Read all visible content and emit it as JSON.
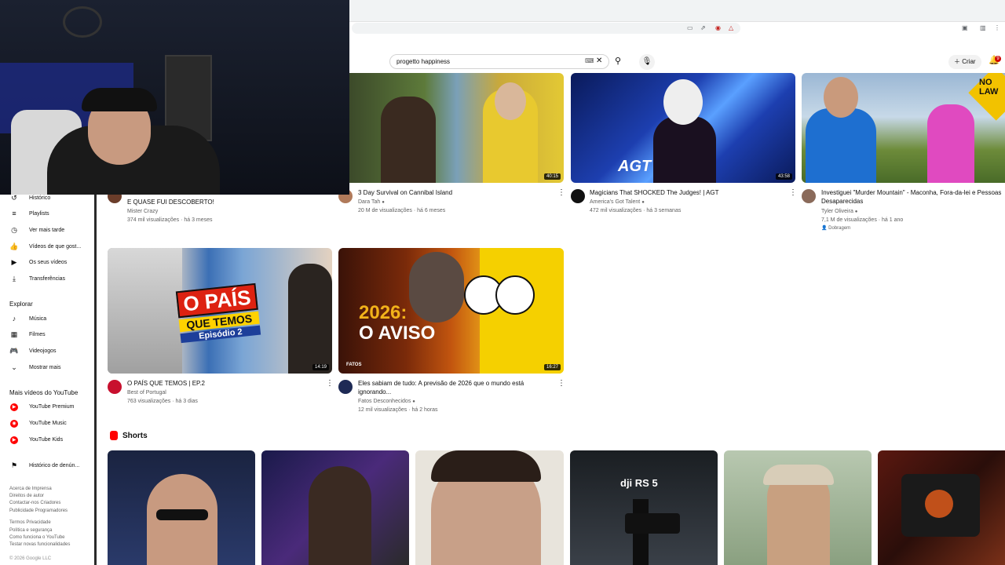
{
  "search": {
    "query": "progetto happiness"
  },
  "header": {
    "create_label": "Criar",
    "notifications_count": "9"
  },
  "sidebar": {
    "items_top": [
      {
        "label": "Histórico",
        "icon": "history-icon"
      },
      {
        "label": "Playlists",
        "icon": "playlist-icon"
      },
      {
        "label": "Ver mais tarde",
        "icon": "clock-icon"
      },
      {
        "label": "Vídeos de que gost...",
        "icon": "thumb-up-icon"
      },
      {
        "label": "Os seus vídeos",
        "icon": "video-icon"
      },
      {
        "label": "Transferências",
        "icon": "download-icon"
      }
    ],
    "explore_heading": "Explorar",
    "explore_items": [
      {
        "label": "Música",
        "icon": "music-icon"
      },
      {
        "label": "Filmes",
        "icon": "film-icon"
      },
      {
        "label": "Videojogos",
        "icon": "gamepad-icon"
      },
      {
        "label": "Mostrar mais",
        "icon": "chevron-down-icon"
      }
    ],
    "more_heading": "Mais vídeos do YouTube",
    "more_items": [
      {
        "label": "YouTube Premium"
      },
      {
        "label": "YouTube Music"
      },
      {
        "label": "YouTube Kids"
      }
    ],
    "report_label": "Histórico de denún...",
    "footer_lines": [
      "Acerca de  Imprensa",
      "Direitos de autor",
      "Contactar-nos  Criadores",
      "Publicidade  Programadores",
      "Termos  Privacidade",
      "Política e segurança",
      "Como funciona o YouTube",
      "Testar novas funcionalidades"
    ],
    "copyright": "© 2026 Google LLC"
  },
  "row1": [
    {
      "title": "E QUASE FUI DESCOBERTO!",
      "channel": "Mister Crazy",
      "stats": "374 mil visualizações · há 3 meses"
    },
    {
      "title": "3 Day Survival on Cannibal Island",
      "channel": "Dara Tah",
      "stats": "20 M de visualizações · há 6 meses",
      "duration": "40:15"
    },
    {
      "title": "Magicians That SHOCKED The Judges! | AGT",
      "channel": "America's Got Talent",
      "stats": "472 mil visualizações · há 3 semanas",
      "duration": "43:58"
    },
    {
      "title": "Investiguei \"Murder Mountain\" - Maconha, Fora-da-lei e Pessoas Desaparecidas",
      "channel": "Tyler Oliveira",
      "stats": "7,1 M de visualizações · há 1 ano",
      "badge": "Dobragem"
    }
  ],
  "row2": [
    {
      "title": "O PAÍS QUE TEMOS | EP.2",
      "channel": "Best of Portugal",
      "stats": "763 visualizações · há 3 dias",
      "duration": "14:19",
      "thumb_text_1": "O PAÍS",
      "thumb_text_2": "QUE TEMOS",
      "thumb_text_3": "Episódio 2"
    },
    {
      "title": "Eles sabiam de tudo: A previsão de 2026 que o mundo está ignorando...",
      "channel": "Fatos Desconhecidos",
      "stats": "12 mil visualizações · há 2 horas",
      "duration": "16:27",
      "thumb_text_1": "2026:",
      "thumb_text_2": "O AVISO",
      "thumb_brand": "FATOS"
    }
  ],
  "thumb_texts": {
    "agt": "AGT",
    "no_law": "NO LAW"
  },
  "shorts": {
    "heading": "Shorts",
    "dji_text": "dji RS 5"
  }
}
